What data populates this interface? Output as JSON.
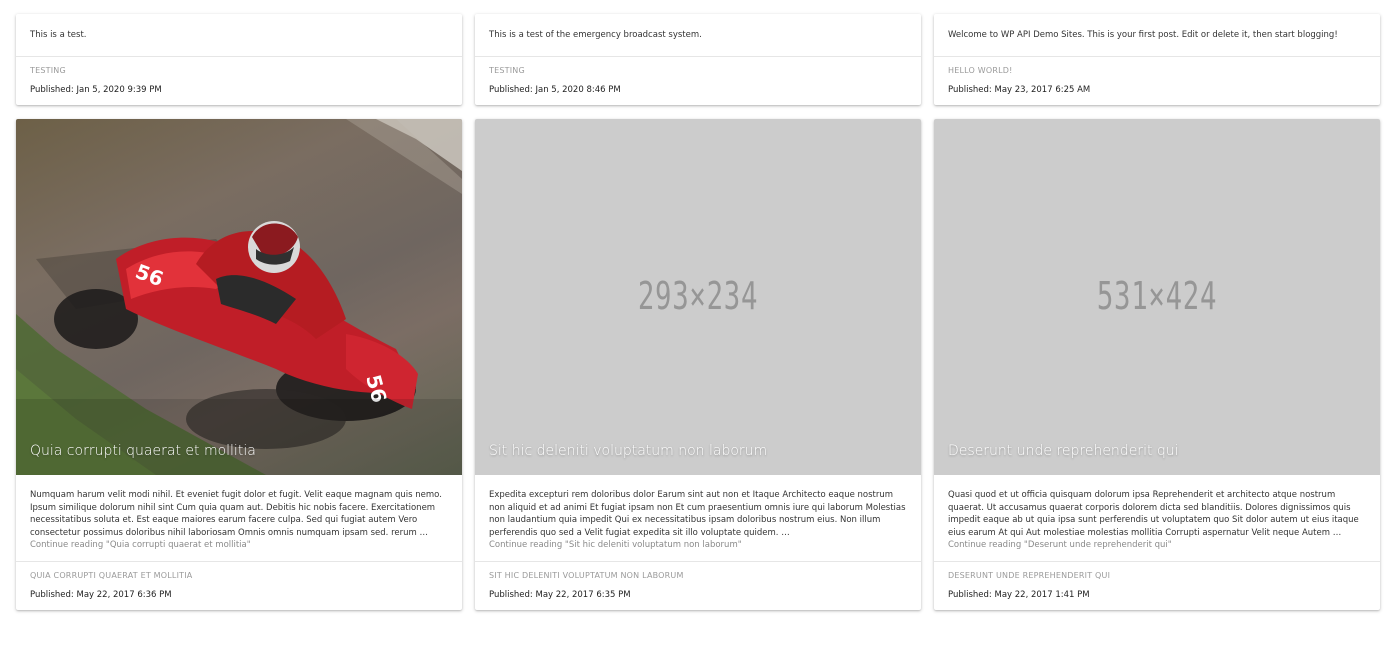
{
  "cards": [
    {
      "text": "This is a test.",
      "category": "TESTING",
      "published": "Published: Jan 5, 2020 9:39 PM"
    },
    {
      "text": "This is a test of the emergency broadcast system.",
      "category": "TESTING",
      "published": "Published: Jan 5, 2020 8:46 PM"
    },
    {
      "text": "Welcome to WP API Demo Sites. This is your first post. Edit or delete it, then start blogging!",
      "category": "HELLO WORLD!",
      "published": "Published: May 23, 2017 6:25 AM"
    },
    {
      "title": "Quia corrupti quaerat et mollitia",
      "excerpt": "Numquam harum velit modi nihil. Et eveniet fugit dolor et fugit. Velit eaque magnam quis nemo. Ipsum similique dolorum nihil sint Cum quia quam aut. Debitis hic nobis facere. Exercitationem necessitatibus soluta et. Est eaque maiores earum facere culpa. Sed qui fugiat autem Vero consectetur possimus doloribus nihil laboriosam Omnis omnis numquam ipsam sed. rerum …",
      "continue": "Continue reading \"Quia corrupti quaerat et mollitia\"",
      "category": "QUIA CORRUPTI QUAERAT ET MOLLITIA",
      "published": "Published: May 22, 2017 6:36 PM"
    },
    {
      "title": "Sit hic deleniti voluptatum non laborum",
      "image_placeholder": "293×234",
      "excerpt": "Expedita excepturi rem doloribus dolor Earum sint aut non et Itaque Architecto eaque nostrum non aliquid et ad animi Et fugiat ipsam non Et cum praesentium omnis iure qui laborum Molestias non laudantium quia impedit Qui ex necessitatibus ipsam doloribus nostrum eius. Non illum perferendis quo sed a Velit fugiat expedita sit illo voluptate quidem. …",
      "continue": "Continue reading \"Sit hic deleniti voluptatum non laborum\"",
      "category": "SIT HIC DELENITI VOLUPTATUM NON LABORUM",
      "published": "Published: May 22, 2017 6:35 PM"
    },
    {
      "title": "Deserunt unde reprehenderit qui",
      "image_placeholder": "531×424",
      "excerpt": "Quasi quod et ut officia quisquam dolorum ipsa Reprehenderit et architecto atque nostrum quaerat. Ut accusamus quaerat corporis dolorem dicta sed blanditiis. Dolores dignissimos quis impedit eaque ab ut quia ipsa sunt perferendis ut voluptatem quo Sit dolor autem ut eius itaque eius earum At qui Aut molestiae molestias mollitia Corrupti aspernatur Velit neque Autem …",
      "continue": "Continue reading \"Deserunt unde reprehenderit qui\"",
      "category": "DESERUNT UNDE REPREHENDERIT QUI",
      "published": "Published: May 22, 2017 1:41 PM"
    }
  ],
  "moto_numbers": [
    "56",
    "56"
  ]
}
